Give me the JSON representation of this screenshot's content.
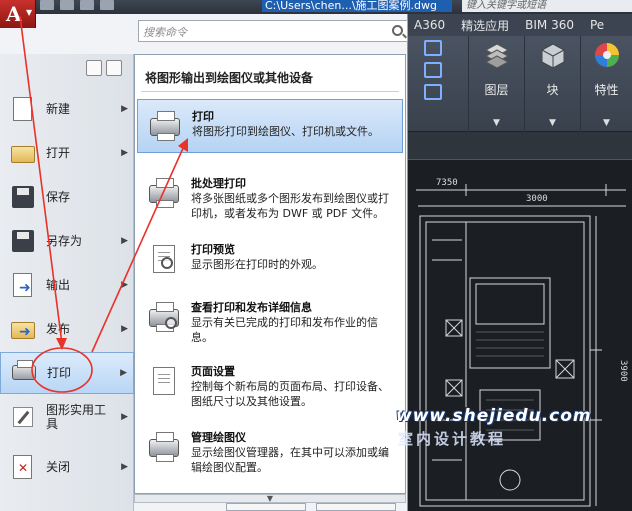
{
  "title_bar": {
    "filename": "C:\\Users\\chen...\\施工图案例.dwg",
    "search_placeholder": "键入关键字或短语"
  },
  "ribbon": {
    "tabs": [
      "A360",
      "精选应用",
      "BIM 360",
      "Pe"
    ],
    "panels": [
      {
        "label": "图层"
      },
      {
        "label": "块"
      },
      {
        "label": "特性"
      }
    ]
  },
  "app_menu": {
    "search_placeholder": "搜索命令",
    "left_items": [
      {
        "label": "新建",
        "has_arrow": true
      },
      {
        "label": "打开",
        "has_arrow": true
      },
      {
        "label": "保存",
        "has_arrow": false
      },
      {
        "label": "另存为",
        "has_arrow": true
      },
      {
        "label": "输出",
        "has_arrow": true
      },
      {
        "label": "发布",
        "has_arrow": true
      },
      {
        "label": "打印",
        "has_arrow": true
      },
      {
        "label": "图形实用工具",
        "has_arrow": true
      },
      {
        "label": "关闭",
        "has_arrow": true
      }
    ],
    "submenu": {
      "title": "将图形输出到绘图仪或其他设备",
      "items": [
        {
          "title": "打印",
          "desc": "将图形打印到绘图仪、打印机或文件。"
        },
        {
          "title": "批处理打印",
          "desc": "将多张图纸或多个图形发布到绘图仪或打印机，或者发布为 DWF 或 PDF 文件。"
        },
        {
          "title": "打印预览",
          "desc": "显示图形在打印时的外观。"
        },
        {
          "title": "查看打印和发布详细信息",
          "desc": "显示有关已完成的打印和发布作业的信息。"
        },
        {
          "title": "页面设置",
          "desc": "控制每个新布局的页面布局、打印设备、图纸尺寸以及其他设置。"
        },
        {
          "title": "管理绘图仪",
          "desc": "显示绘图仪管理器，在其中可以添加或编辑绘图仪配置。"
        }
      ]
    }
  },
  "drawing": {
    "dim_top": "7350",
    "dim_mid": "3000",
    "dim_side": "3900"
  },
  "watermark": {
    "url": "www.shejiedu.com",
    "text": "室内设计教程"
  },
  "colors": {
    "accent_red": "#e8322a",
    "highlight_blue": "#b8d6f5",
    "autocad_red": "#c8312c"
  }
}
